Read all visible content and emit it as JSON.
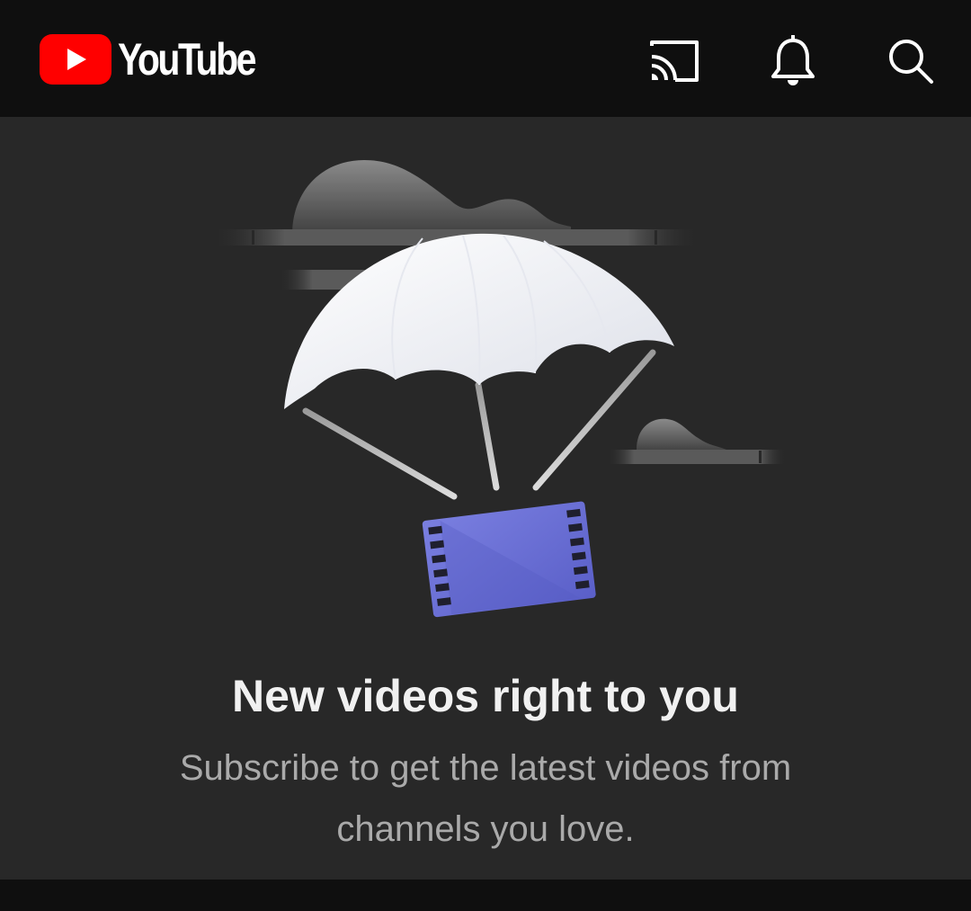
{
  "header": {
    "logo_text": "YouTube",
    "icons": [
      "cast-icon",
      "notifications-bell-icon",
      "search-icon"
    ]
  },
  "empty_state": {
    "title": "New videos right to you",
    "subtitle": "Subscribe to get the latest videos from channels you love."
  },
  "colors": {
    "header_bg": "#0f0f0f",
    "page_bg": "#282828",
    "brand_red": "#ff0000",
    "title_text": "#f1f1f1",
    "subtitle_text": "#aaaaaa",
    "film_purple": "#6b6fd4"
  }
}
